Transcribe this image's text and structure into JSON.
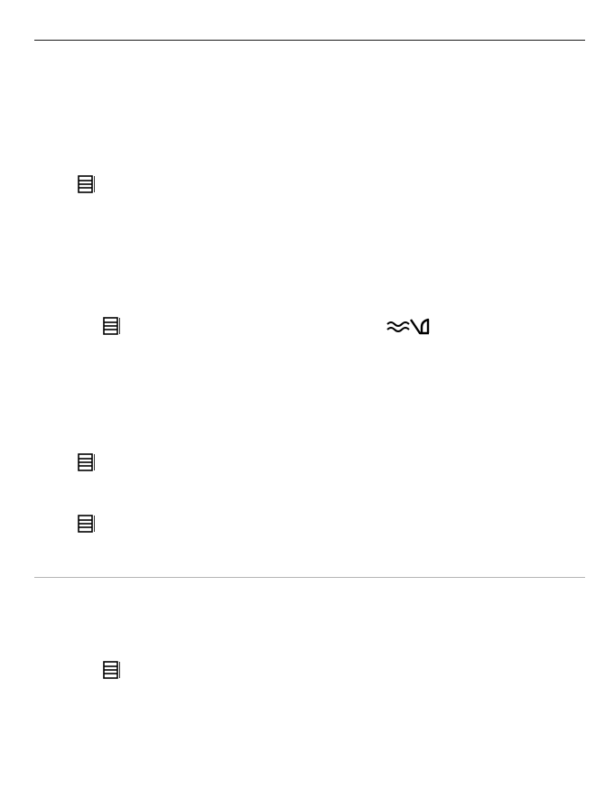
{
  "page": {
    "icons": {
      "menu": "menu-key-icon",
      "traffic_route": "traffic-route-icon"
    },
    "colors": {
      "text": "#000000",
      "top_rule": "#1a1a1a",
      "section_rule": "#b5b5b5"
    }
  }
}
